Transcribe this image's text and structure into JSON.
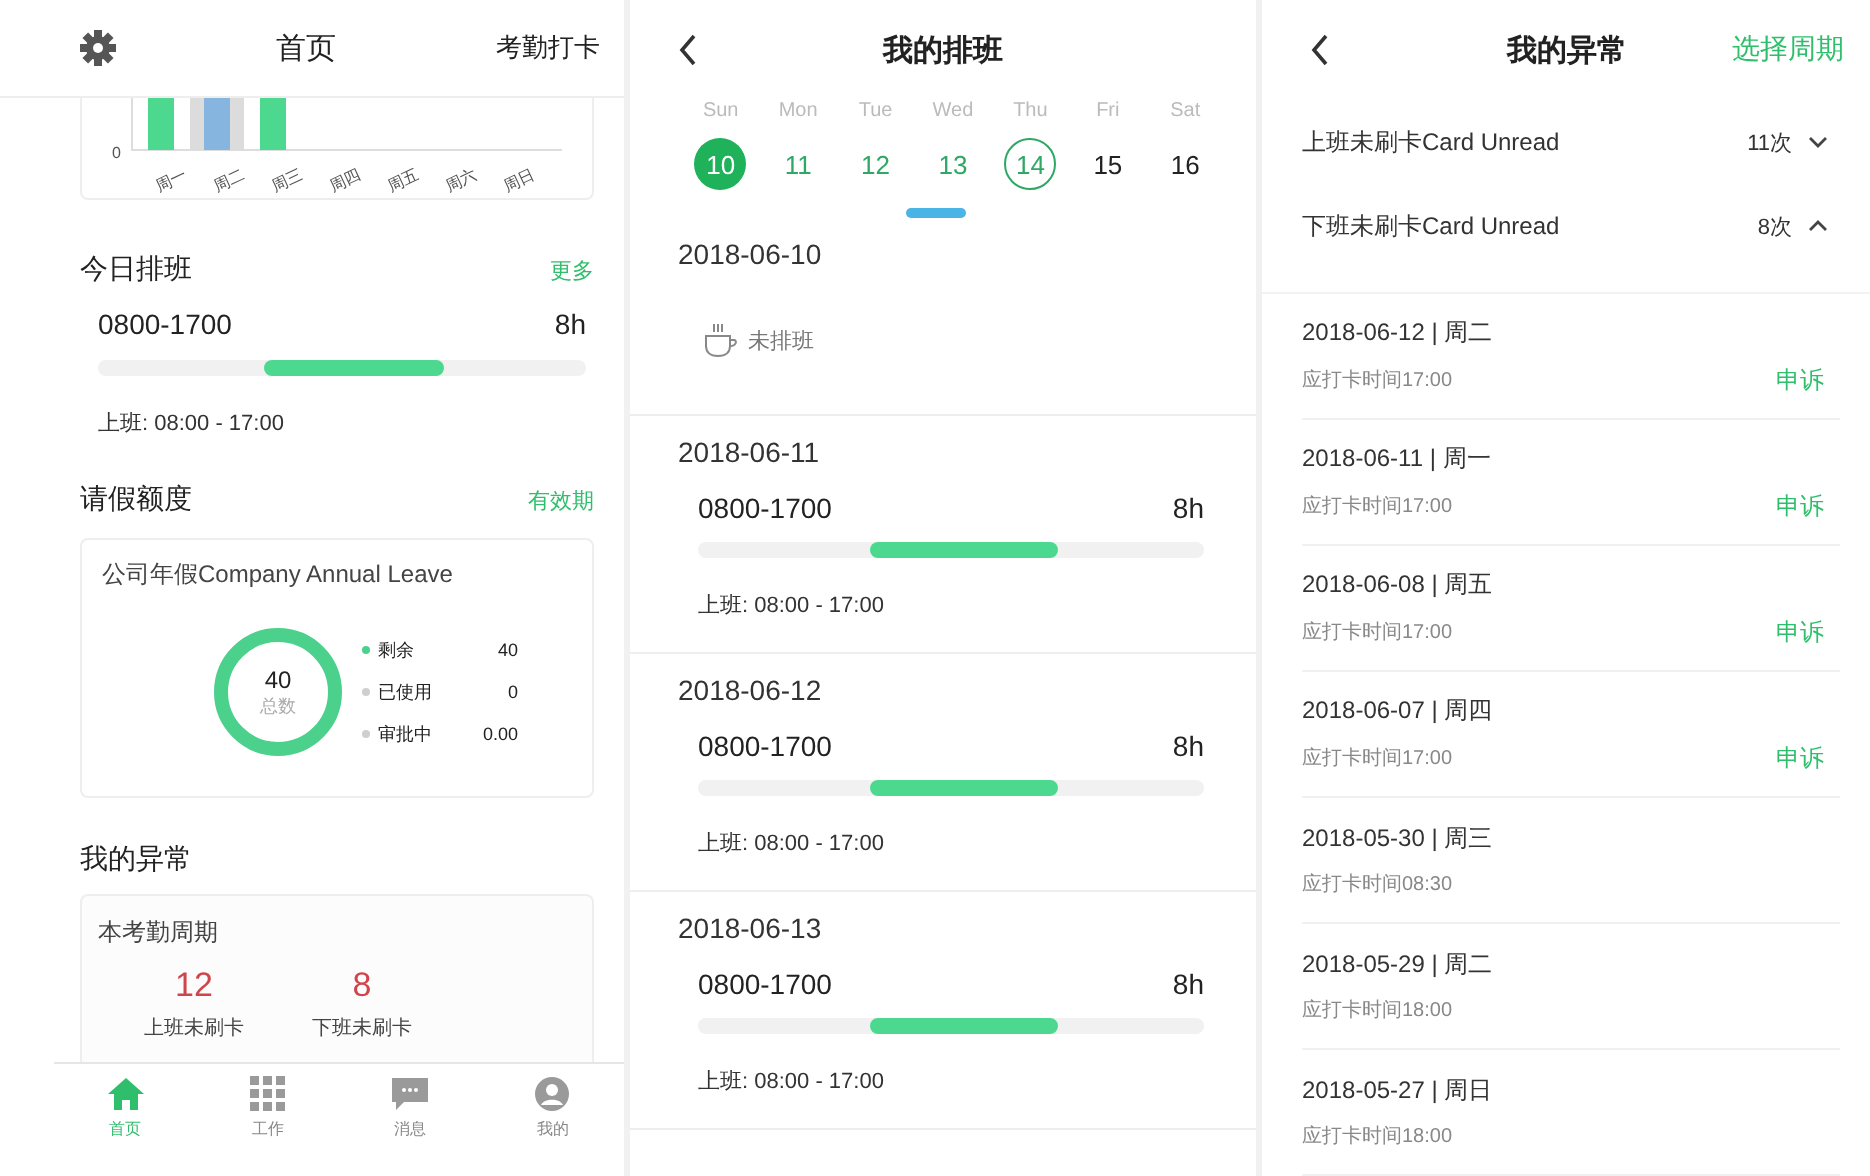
{
  "home": {
    "header": {
      "title": "首页",
      "action": "考勤打卡"
    },
    "week_chart": {
      "y_tick": "0",
      "days": [
        "周一",
        "周二",
        "周三",
        "周四",
        "周五",
        "周六",
        "周日"
      ]
    },
    "today_schedule": {
      "title": "今日排班",
      "more": "更多",
      "time": "0800-1700",
      "hours": "8h",
      "detail": "上班: 08:00 - 17:00"
    },
    "leave": {
      "title": "请假额度",
      "link": "有效期",
      "card_title": "公司年假Company Annual Leave",
      "total": "40",
      "total_label": "总数",
      "legend": [
        {
          "label": "剩余",
          "value": "40",
          "color": "#4cd18c"
        },
        {
          "label": "已使用",
          "value": "0",
          "color": "#cfcfcf"
        },
        {
          "label": "审批中",
          "value": "0.00",
          "color": "#cfcfcf"
        }
      ]
    },
    "abnormal": {
      "title": "我的异常",
      "card_title": "本考勤周期",
      "stats": [
        {
          "value": "12",
          "label": "上班未刷卡"
        },
        {
          "value": "8",
          "label": "下班未刷卡"
        }
      ]
    },
    "tab_bar": [
      {
        "label": "首页",
        "kind": "home",
        "selected": true
      },
      {
        "label": "工作",
        "kind": "grid",
        "selected": false
      },
      {
        "label": "消息",
        "kind": "chat",
        "selected": false
      },
      {
        "label": "我的",
        "kind": "person",
        "selected": false
      }
    ]
  },
  "schedule": {
    "title": "我的排班",
    "week": [
      {
        "weekday": "Sun",
        "day": "10",
        "selected": true,
        "today": false,
        "scheduled": true
      },
      {
        "weekday": "Mon",
        "day": "11",
        "selected": false,
        "today": false,
        "scheduled": true
      },
      {
        "weekday": "Tue",
        "day": "12",
        "selected": false,
        "today": false,
        "scheduled": true
      },
      {
        "weekday": "Wed",
        "day": "13",
        "selected": false,
        "today": false,
        "scheduled": true
      },
      {
        "weekday": "Thu",
        "day": "14",
        "selected": false,
        "today": true,
        "scheduled": true
      },
      {
        "weekday": "Fri",
        "day": "15",
        "selected": false,
        "today": false,
        "scheduled": false
      },
      {
        "weekday": "Sat",
        "day": "16",
        "selected": false,
        "today": false,
        "scheduled": false
      }
    ],
    "days": [
      {
        "date": "2018-06-10",
        "kind": "off",
        "note": "未排班"
      },
      {
        "date": "2018-06-11",
        "kind": "shift",
        "time": "0800-1700",
        "hours": "8h",
        "detail": "上班: 08:00 - 17:00"
      },
      {
        "date": "2018-06-12",
        "kind": "shift",
        "time": "0800-1700",
        "hours": "8h",
        "detail": "上班: 08:00 - 17:00"
      },
      {
        "date": "2018-06-13",
        "kind": "shift",
        "time": "0800-1700",
        "hours": "8h",
        "detail": "上班: 08:00 - 17:00"
      }
    ]
  },
  "exceptions": {
    "title": "我的异常",
    "action": "选择周期",
    "groups": [
      {
        "label": "上班未刷卡Card Unread",
        "count": "11次",
        "expanded": false
      },
      {
        "label": "下班未刷卡Card Unread",
        "count": "8次",
        "expanded": true
      }
    ],
    "records": [
      {
        "date": "2018-06-12 | 周二",
        "expected": "应打卡时间17:00",
        "appeal": "申诉"
      },
      {
        "date": "2018-06-11 | 周一",
        "expected": "应打卡时间17:00",
        "appeal": "申诉"
      },
      {
        "date": "2018-06-08 | 周五",
        "expected": "应打卡时间17:00",
        "appeal": "申诉"
      },
      {
        "date": "2018-06-07 | 周四",
        "expected": "应打卡时间17:00",
        "appeal": "申诉"
      },
      {
        "date": "2018-05-30 | 周三",
        "expected": "应打卡时间08:30"
      },
      {
        "date": "2018-05-29 | 周二",
        "expected": "应打卡时间18:00"
      },
      {
        "date": "2018-05-27 | 周日",
        "expected": "应打卡时间18:00"
      }
    ]
  }
}
